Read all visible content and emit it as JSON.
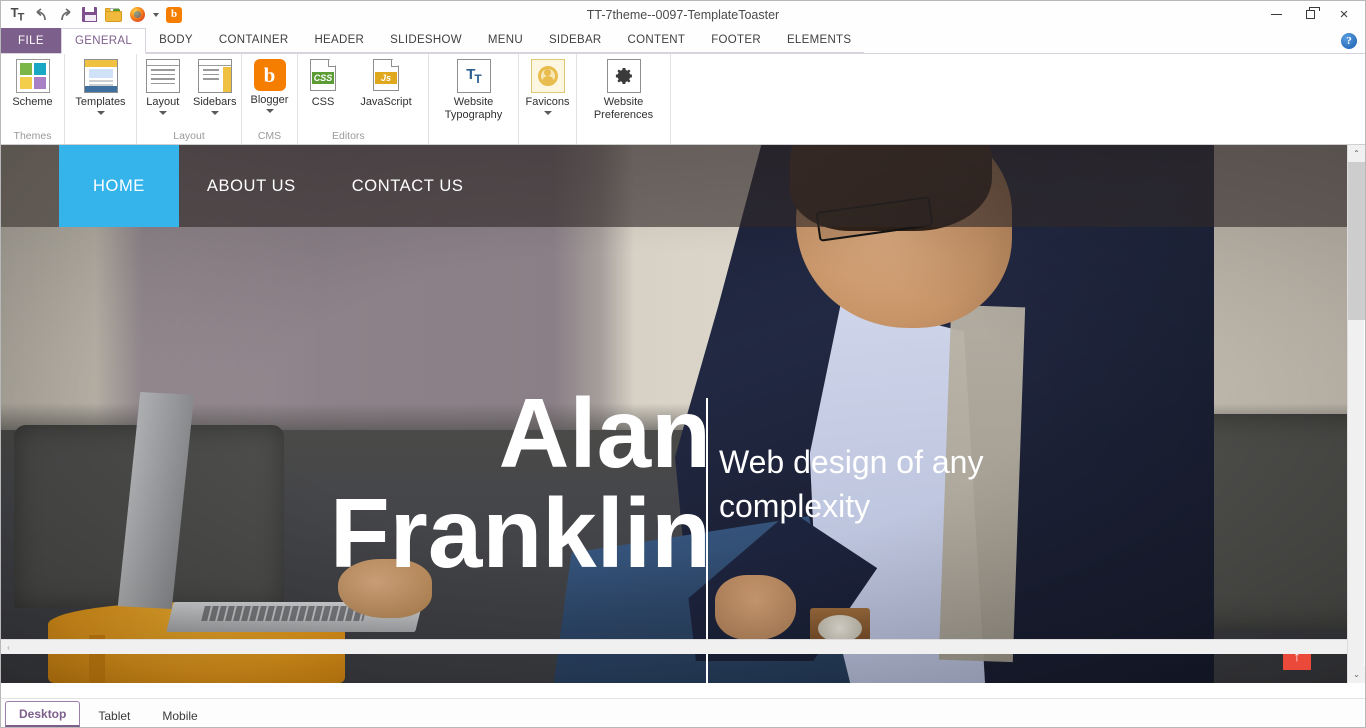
{
  "window": {
    "title": "TT-7theme--0097-TemplateToaster",
    "minimize_label": "",
    "restore_label": "",
    "close_label": "×",
    "help_label": "?"
  },
  "quick_access": {
    "items": [
      {
        "name": "typography-quick-icon",
        "label": "T"
      },
      {
        "name": "undo-icon",
        "label": "↶"
      },
      {
        "name": "redo-icon",
        "label": "↷"
      },
      {
        "name": "save-icon",
        "label": ""
      },
      {
        "name": "open-folder-icon",
        "label": ""
      },
      {
        "name": "firefox-preview-icon",
        "label": ""
      },
      {
        "name": "preview-dropdown-caret",
        "label": ""
      },
      {
        "name": "blogger-quick-icon",
        "label": "b"
      }
    ]
  },
  "ribbon": {
    "file_tab": "FILE",
    "tabs": [
      {
        "label": "GENERAL",
        "active": true
      },
      {
        "label": "BODY",
        "active": false
      },
      {
        "label": "CONTAINER",
        "active": false
      },
      {
        "label": "HEADER",
        "active": false
      },
      {
        "label": "SLIDESHOW",
        "active": false
      },
      {
        "label": "MENU",
        "active": false
      },
      {
        "label": "SIDEBAR",
        "active": false
      },
      {
        "label": "CONTENT",
        "active": false
      },
      {
        "label": "FOOTER",
        "active": false
      },
      {
        "label": "ELEMENTS",
        "active": false
      }
    ],
    "groups": [
      {
        "label": "Themes",
        "buttons": [
          {
            "label": "Scheme",
            "icon": "color-scheme-icon",
            "caret": false
          }
        ]
      },
      {
        "label": "",
        "buttons": [
          {
            "label": "Templates",
            "icon": "templates-icon",
            "caret": true
          }
        ]
      },
      {
        "label": "Layout",
        "buttons": [
          {
            "label": "Layout",
            "icon": "layout-icon",
            "caret": true
          },
          {
            "label": "Sidebars",
            "icon": "sidebars-icon",
            "caret": true
          }
        ]
      },
      {
        "label": "CMS",
        "buttons": [
          {
            "label": "Blogger",
            "icon": "blogger-icon",
            "caret": true
          }
        ]
      },
      {
        "label": "Editors",
        "buttons": [
          {
            "label": "CSS",
            "icon": "css-file-icon",
            "caret": false,
            "badge": "CSS",
            "badge_color": "#5b9c35"
          },
          {
            "label": "JavaScript",
            "icon": "js-file-icon",
            "caret": false,
            "badge": "Js",
            "badge_color": "#e0a81c"
          }
        ]
      },
      {
        "label": "",
        "buttons": [
          {
            "label": "Website Typography",
            "icon": "website-typography-icon",
            "caret": false
          }
        ]
      },
      {
        "label": "",
        "buttons": [
          {
            "label": "Favicons",
            "icon": "favicons-icon",
            "caret": true
          }
        ]
      },
      {
        "label": "",
        "buttons": [
          {
            "label": "Website Preferences",
            "icon": "gear-icon",
            "caret": false
          }
        ]
      }
    ],
    "scheme_colors": [
      "#7ab648",
      "#19a8c4",
      "#f2ce4b",
      "#a77fc4"
    ]
  },
  "preview": {
    "nav": {
      "items": [
        {
          "label": "HOME",
          "active": true
        },
        {
          "label": "ABOUT US",
          "active": false
        },
        {
          "label": "CONTACT US",
          "active": false
        }
      ],
      "active_color": "#35b4ec",
      "overlay_color": "rgba(48,40,40,0.62)"
    },
    "hero": {
      "name_line1": "Alan",
      "name_line2": "Franklin",
      "tagline": "Web design of any complexity",
      "scroll_top_icon": "↑",
      "scroll_top_color": "#eb4a3a"
    },
    "scrollbar": {
      "up_arrow": "⌃",
      "down_arrow": "⌄",
      "left_arrow": "‹"
    }
  },
  "statusbar": {
    "device_tabs": [
      {
        "label": "Desktop",
        "active": true
      },
      {
        "label": "Tablet",
        "active": false
      },
      {
        "label": "Mobile",
        "active": false
      }
    ]
  }
}
